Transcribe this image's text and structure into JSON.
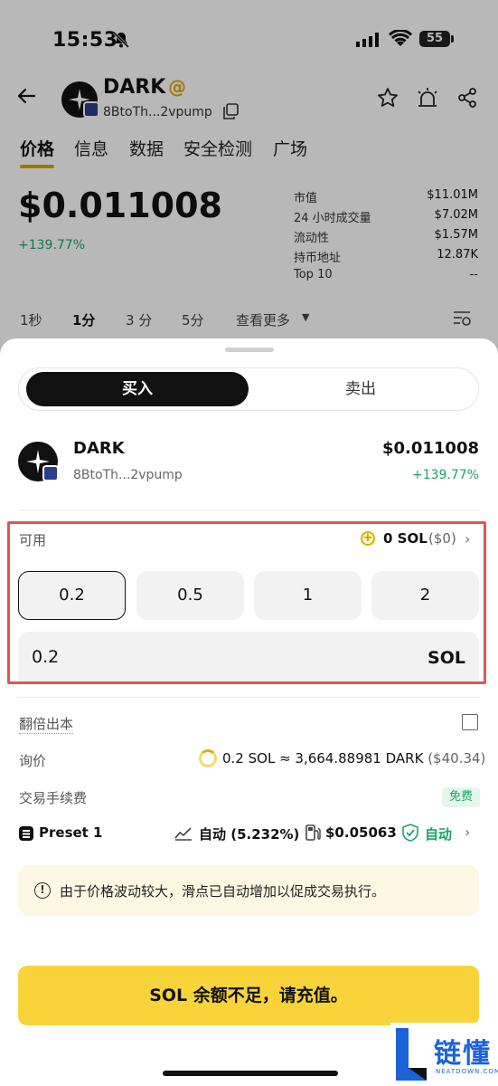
{
  "status_bar": {
    "time": "15:53",
    "battery": "55"
  },
  "header": {
    "token_name": "DARK",
    "address": "8BtoTh...2vpump"
  },
  "tabs": [
    "价格",
    "信息",
    "数据",
    "安全检测",
    "广场"
  ],
  "price_panel": {
    "price": "$0.011008",
    "change": "+139.77%",
    "stats": [
      {
        "label": "市值",
        "value": "$11.01M"
      },
      {
        "label": "24 小时成交量",
        "value": "$7.02M"
      },
      {
        "label": "流动性",
        "value": "$1.57M"
      },
      {
        "label": "持币地址",
        "value": "12.87K"
      },
      {
        "label": "Top 10",
        "value": "--"
      }
    ]
  },
  "intervals": [
    "1秒",
    "1分",
    "3 分",
    "5分",
    "查看更多"
  ],
  "trade_sheet": {
    "toggle": {
      "buy": "买入",
      "sell": "卖出"
    },
    "token": {
      "name": "DARK",
      "address": "8BtoTh...2vpump",
      "price": "$0.011008",
      "change": "+139.77%"
    },
    "available": {
      "label": "可用",
      "value": "0 SOL",
      "usd": "($0)"
    },
    "amount_options": [
      "0.2",
      "0.5",
      "1",
      "2"
    ],
    "selected_amount_index": 0,
    "amount": {
      "value": "0.2",
      "unit": "SOL"
    },
    "double_label": "翻倍出本",
    "quote": {
      "label": "询价",
      "value": "0.2 SOL ≈ 3,664.88981 DARK",
      "usd": "($40.34)"
    },
    "fee": {
      "label": "交易手续费",
      "badge": "免费"
    },
    "preset": {
      "label": "Preset 1",
      "slippage": "自动 (5.232%)",
      "gas": "$0.05063",
      "mev": "自动"
    },
    "notice": "由于价格波动较大，滑点已自动增加以促成交易执行。",
    "cta": "SOL 余额不足，请充值。"
  },
  "watermark": {
    "brand": "链懂",
    "sub": "NEATDOWN.COM"
  },
  "colors": {
    "accent_yellow": "#f8d43a",
    "positive_green": "#1ca36a",
    "highlight_red": "#e55353"
  }
}
